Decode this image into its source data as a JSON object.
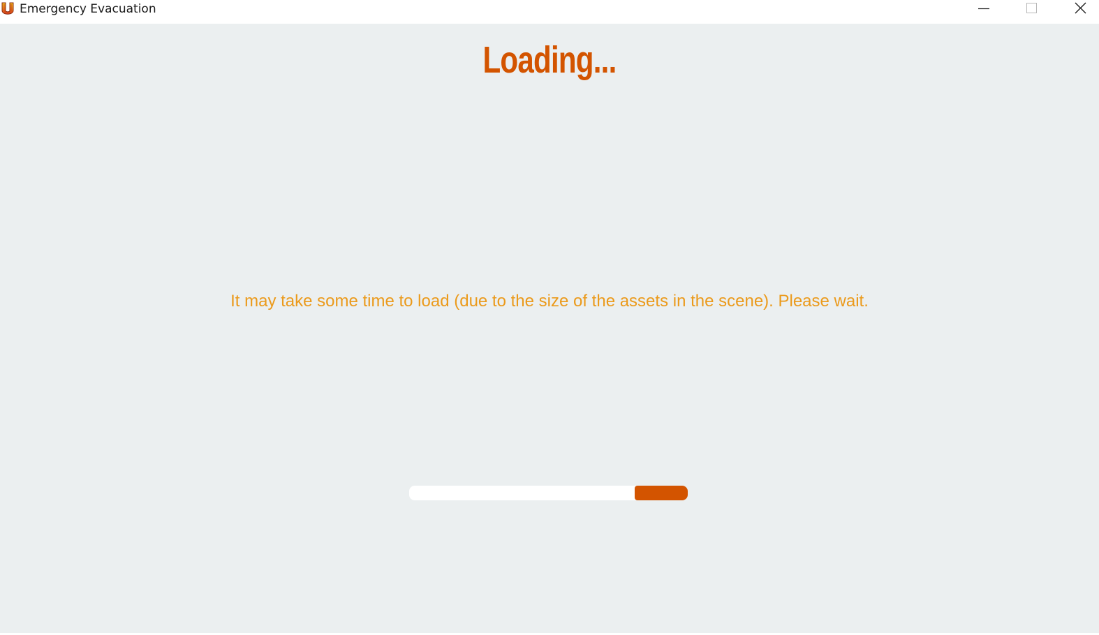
{
  "window": {
    "title": "Emergency Evacuation",
    "icon": "unity-app-icon",
    "controls": {
      "minimize_icon": "minimize-icon",
      "maximize_icon": "maximize-icon",
      "close_icon": "close-icon"
    }
  },
  "loading": {
    "title": "Loading...",
    "message": "It may take some time to load (due to the size of the assets in the scene). Please wait.",
    "progress_fraction": 0.19
  },
  "colors": {
    "accent": "#d35400",
    "message": "#eb9a1b",
    "background": "#ebeff0",
    "track": "#ffffff"
  }
}
